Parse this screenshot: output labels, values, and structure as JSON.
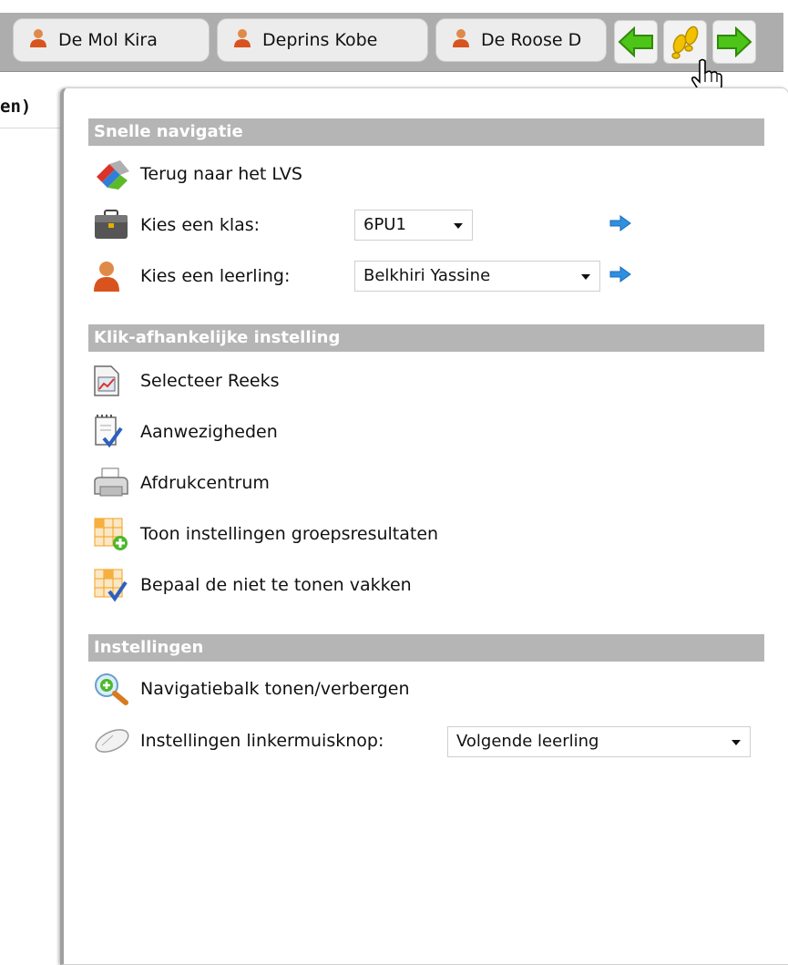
{
  "tabs": [
    {
      "name": "De Mol Kira"
    },
    {
      "name": "Deprins Kobe"
    },
    {
      "name": "De Roose D"
    }
  ],
  "left_header": "en)",
  "sections": {
    "quick_nav": "Snelle navigatie",
    "click_dependent": "Klik-afhankelijke instelling",
    "settings": "Instellingen"
  },
  "quick_nav": {
    "back_to_lvs": "Terug naar het LVS",
    "choose_class_label": "Kies een klas:",
    "class_value": "6PU1",
    "choose_student_label": "Kies een leerling:",
    "student_value": "Belkhiri Yassine"
  },
  "click_dependent": {
    "items": [
      {
        "label": "Selecteer Reeks",
        "icon": "chart-document-icon"
      },
      {
        "label": "Aanwezigheden",
        "icon": "notepad-check-icon"
      },
      {
        "label": "Afdrukcentrum",
        "icon": "printer-icon"
      },
      {
        "label": "Toon instellingen groepsresultaten",
        "icon": "grid-add-icon"
      },
      {
        "label": "Bepaal de niet te tonen vakken",
        "icon": "grid-check-icon"
      }
    ]
  },
  "settings": {
    "navbar_toggle": "Navigatiebalk tonen/verbergen",
    "left_mouse_label": "Instellingen linkermuisknop:",
    "left_mouse_value": "Volgende leerling"
  },
  "colors": {
    "section_bg": "#b5b5b5",
    "green_arrow": "#4cc418",
    "blue_arrow": "#2f8fe0",
    "footprints": "#f2c200"
  }
}
